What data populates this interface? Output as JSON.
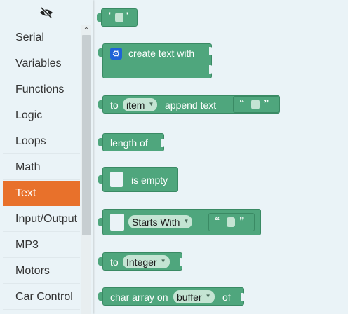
{
  "categories": [
    {
      "label": "Serial"
    },
    {
      "label": "Variables"
    },
    {
      "label": "Functions"
    },
    {
      "label": "Logic"
    },
    {
      "label": "Loops"
    },
    {
      "label": "Math"
    },
    {
      "label": "Text",
      "selected": true
    },
    {
      "label": "Input/Output"
    },
    {
      "label": "MP3"
    },
    {
      "label": "Motors"
    },
    {
      "label": "Car Control"
    }
  ],
  "blocks": {
    "text_literal": {
      "open_quote": "'",
      "close_quote": "'"
    },
    "create_text": {
      "label": "create text with",
      "icon": "gear-icon"
    },
    "append": {
      "to": "to",
      "var": "item",
      "suffix": "append text",
      "open_quote": "“",
      "close_quote": "”"
    },
    "length": {
      "label": "length of"
    },
    "is_empty": {
      "label": "is empty"
    },
    "starts_with": {
      "op": "Starts With",
      "open_quote": "“",
      "close_quote": "”"
    },
    "to_integer": {
      "to": "to",
      "type": "Integer"
    },
    "char_array": {
      "label": "char array on",
      "var": "buffer",
      "suffix": "of"
    }
  },
  "colors": {
    "block": "#4fa67d",
    "selected_category": "#e8712b",
    "gear": "#1e63d6"
  }
}
